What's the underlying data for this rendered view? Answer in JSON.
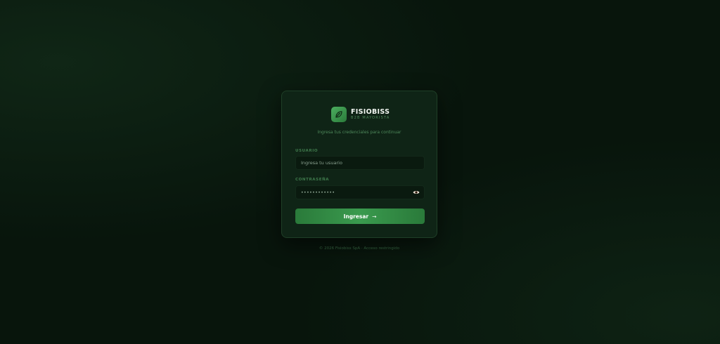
{
  "brand": {
    "name": "FISIOBISS",
    "tagline": "B2B MAYORISTA"
  },
  "login": {
    "subtitle": "Ingresa tus credenciales para continuar",
    "username_label": "USUARIO",
    "username_placeholder": "Ingresa tu usuario",
    "password_label": "CONTRASEÑA",
    "password_value": "••••••••••••",
    "submit_label": "Ingresar",
    "submit_arrow": "→"
  },
  "footer": {
    "text": "© 2026 Fisiobiss SpA · Acceso restringido"
  },
  "icons": {
    "logo": "leaf-icon",
    "password_toggle": "eye-icon"
  },
  "colors": {
    "background": "#08150c",
    "card": "#0f2416",
    "accent": "#3a9a4e",
    "muted_text": "#4f8a5c"
  }
}
